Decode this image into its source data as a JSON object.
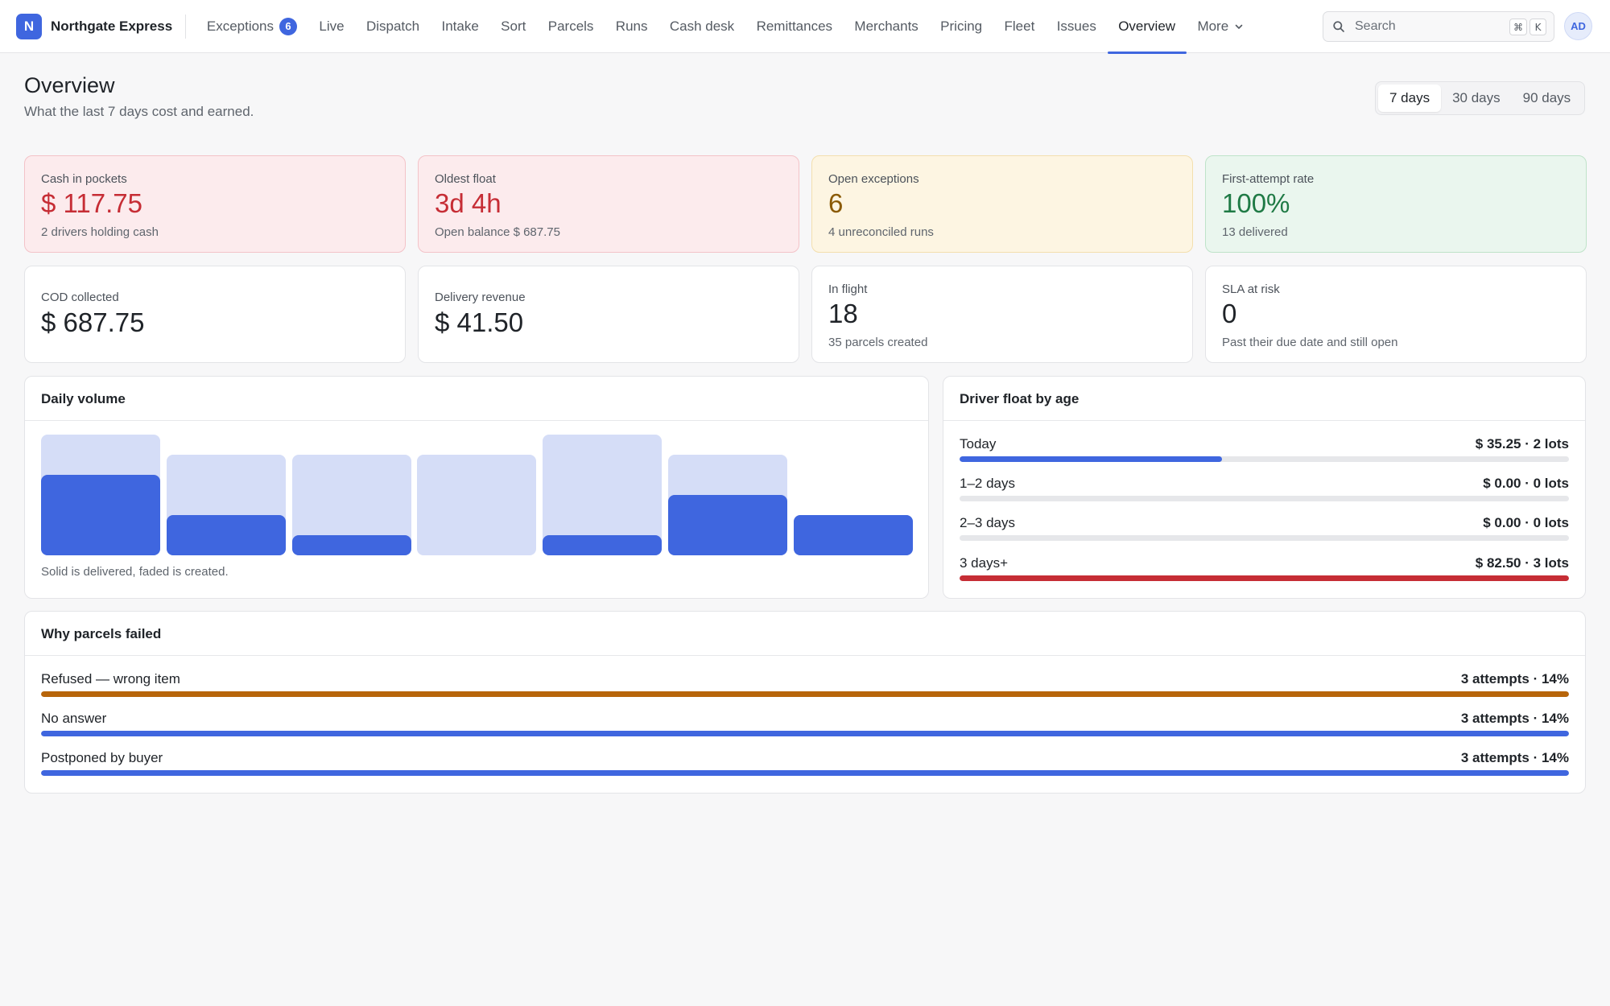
{
  "brand": {
    "logo_letter": "N",
    "name": "Northgate Express"
  },
  "nav": {
    "items": [
      {
        "label": "Exceptions",
        "badge": "6"
      },
      {
        "label": "Live"
      },
      {
        "label": "Dispatch"
      },
      {
        "label": "Intake"
      },
      {
        "label": "Sort"
      },
      {
        "label": "Parcels"
      },
      {
        "label": "Runs"
      },
      {
        "label": "Cash desk"
      },
      {
        "label": "Remittances"
      },
      {
        "label": "Merchants"
      },
      {
        "label": "Pricing"
      },
      {
        "label": "Fleet"
      },
      {
        "label": "Issues"
      },
      {
        "label": "Overview",
        "active": true
      }
    ],
    "more_label": "More"
  },
  "search": {
    "placeholder": "Search",
    "shortcut_mod": "⌘",
    "shortcut_key": "K"
  },
  "user": {
    "initials": "AD"
  },
  "header": {
    "title": "Overview",
    "subtitle": "What the last 7 days cost and earned."
  },
  "range": {
    "options": [
      "7 days",
      "30 days",
      "90 days"
    ],
    "selected": "7 days"
  },
  "cards": {
    "cash_in_pockets": {
      "label": "Cash in pockets",
      "value": "$ 117.75",
      "sub": "2 drivers holding cash"
    },
    "oldest_float": {
      "label": "Oldest float",
      "value": "3d 4h",
      "sub": "Open balance $ 687.75"
    },
    "open_exceptions": {
      "label": "Open exceptions",
      "value": "6",
      "sub": "4 unreconciled runs"
    },
    "first_attempt": {
      "label": "First-attempt rate",
      "value": "100%",
      "sub": "13 delivered"
    },
    "cod_collected": {
      "label": "COD collected",
      "value": "$ 687.75"
    },
    "delivery_revenue": {
      "label": "Delivery revenue",
      "value": "$ 41.50"
    },
    "in_flight": {
      "label": "In flight",
      "value": "18",
      "sub": "35 parcels created"
    },
    "sla_at_risk": {
      "label": "SLA at risk",
      "value": "0",
      "sub": "Past their due date and still open"
    }
  },
  "daily_volume": {
    "title": "Daily volume",
    "caption": "Solid is delivered, faded is created.",
    "colors": {
      "delivered": "#3f66df",
      "created": "#d5ddf7"
    }
  },
  "chart_data": {
    "type": "bar",
    "title": "Daily volume",
    "categories": [
      "",
      "",
      "",
      "",
      "",
      "",
      ""
    ],
    "series": [
      {
        "values": [
          6,
          5,
          5,
          5,
          6,
          5,
          2
        ]
      },
      {
        "values": [
          4,
          2,
          1,
          0,
          1,
          3,
          2
        ]
      }
    ],
    "ylim": [
      0,
      6
    ]
  },
  "driver_float": {
    "title": "Driver float by age",
    "rows": [
      {
        "label": "Today",
        "value": "$ 35.25 · 2 lots",
        "fraction": 0.43,
        "color": "#3f66df"
      },
      {
        "label": "1–2 days",
        "value": "$ 0.00 · 0 lots",
        "fraction": 0,
        "color": "#3f66df"
      },
      {
        "label": "2–3 days",
        "value": "$ 0.00 · 0 lots",
        "fraction": 0,
        "color": "#3f66df"
      },
      {
        "label": "3 days+",
        "value": "$ 82.50 · 3 lots",
        "fraction": 1,
        "color": "#c62d35"
      }
    ]
  },
  "failed": {
    "title": "Why parcels failed",
    "rows": [
      {
        "label": "Refused — wrong item",
        "value": "3 attempts · 14%",
        "fraction": 1,
        "color": "#b7650a"
      },
      {
        "label": "No answer",
        "value": "3 attempts · 14%",
        "fraction": 1,
        "color": "#3f66df"
      },
      {
        "label": "Postponed by buyer",
        "value": "3 attempts · 14%",
        "fraction": 1,
        "color": "#3f66df"
      }
    ]
  }
}
